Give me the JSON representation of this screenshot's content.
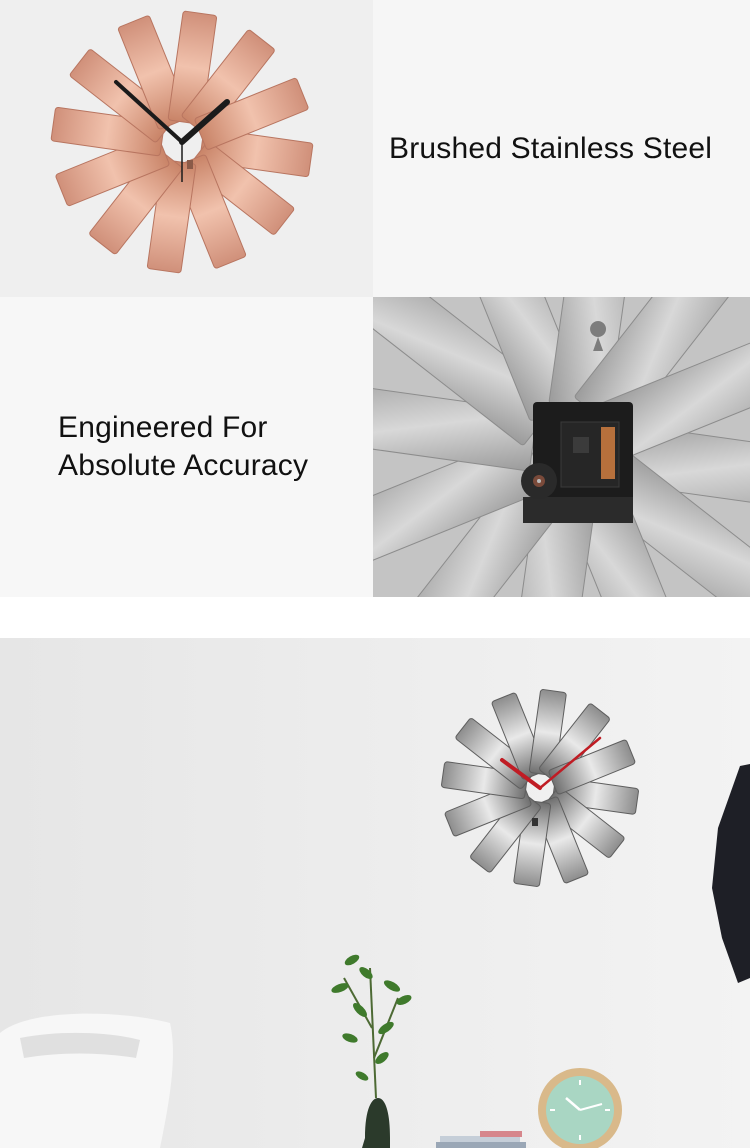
{
  "panels": {
    "feature1": {
      "caption": "Brushed Stainless Steel",
      "image": "copper-ribbon-wall-clock"
    },
    "feature2": {
      "caption_line1": "Engineered For",
      "caption_line2": "Absolute Accuracy",
      "image": "clock-movement-back-view"
    },
    "lifestyle": {
      "image": "steel-ribbon-clock-on-wall-scene"
    }
  },
  "colors": {
    "copper": "#d9a08a",
    "steel": "#bdbdbd",
    "second_hand": "#c8202a",
    "green_clock_face": "#a9d6c3"
  }
}
